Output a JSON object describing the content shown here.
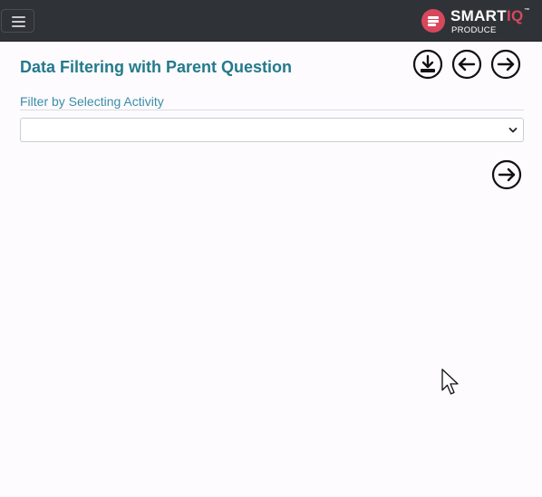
{
  "navbar": {
    "menu_icon": "hamburger-menu-icon",
    "logo": {
      "brand_main": "SMART",
      "brand_accent": "IQ",
      "trademark": "™",
      "subtitle": "PRODUCE",
      "badge_icon": "list-lines-icon",
      "colors": {
        "background": "#2f3338",
        "accent": "#d7485d",
        "text": "#ffffff"
      }
    }
  },
  "header": {
    "title": "Data Filtering with Parent Question",
    "actions": [
      {
        "icon": "download-circle-icon"
      },
      {
        "icon": "arrow-left-circle-icon"
      },
      {
        "icon": "arrow-right-circle-icon"
      }
    ]
  },
  "filter": {
    "label": "Filter by Selecting Activity",
    "select": {
      "value": "",
      "caret_icon": "chevron-down-icon"
    }
  },
  "footer_actions": {
    "next_icon": "arrow-right-circle-icon"
  },
  "pointer": {
    "icon": "mouse-cursor-icon"
  },
  "colors": {
    "title": "#237a8c",
    "label": "#3a8ea8",
    "page_background": "#fdfbfd"
  }
}
